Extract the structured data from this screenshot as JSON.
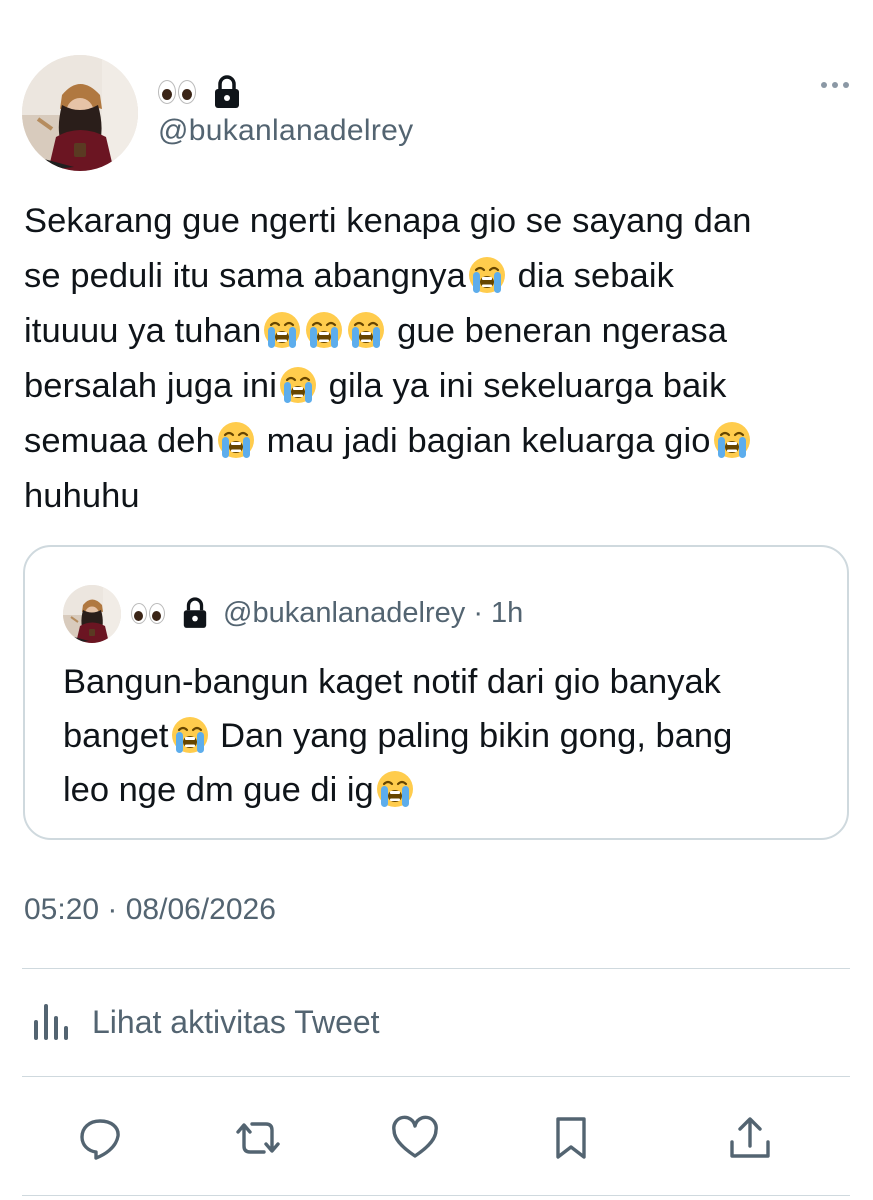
{
  "author": {
    "handle": "@bukanlanadelrey",
    "display_emoji": "eyes",
    "protected": true
  },
  "tweet": {
    "lines": [
      {
        "t1": "Sekarang gue ngerti kenapa gio se sayang dan"
      },
      {
        "t1": "se peduli itu sama abangnya",
        "t2": " dia sebaik"
      },
      {
        "t1": "ituuuu ya tuhan",
        "t2": " gue beneran ngerasa"
      },
      {
        "t1": "bersalah juga ini",
        "t2": " gila ya ini sekeluarga baik"
      },
      {
        "t1": "semuaa deh",
        "t2": " mau jadi bagian keluarga gio"
      },
      {
        "t1": "huhuhu"
      }
    ],
    "emoji": "loudly-crying-face",
    "timestamp": "05:20 · 08/06/2026"
  },
  "quoted_tweet": {
    "handle": "@bukanlanadelrey",
    "time": "· 1h",
    "lines": [
      {
        "t1": "Bangun-bangun kaget notif dari gio banyak"
      },
      {
        "t1": "banget",
        "t2": " Dan yang paling bikin gong, bang"
      },
      {
        "t1": "leo nge dm gue di ig"
      }
    ]
  },
  "activity": {
    "label": "Lihat aktivitas Tweet",
    "icon": "bar-chart-icon"
  },
  "actions": [
    "reply-icon",
    "retweet-icon",
    "like-icon",
    "bookmark-icon",
    "share-icon"
  ],
  "colors": {
    "text": "#0f1419",
    "secondary": "#536471",
    "border": "#cfd9de"
  }
}
